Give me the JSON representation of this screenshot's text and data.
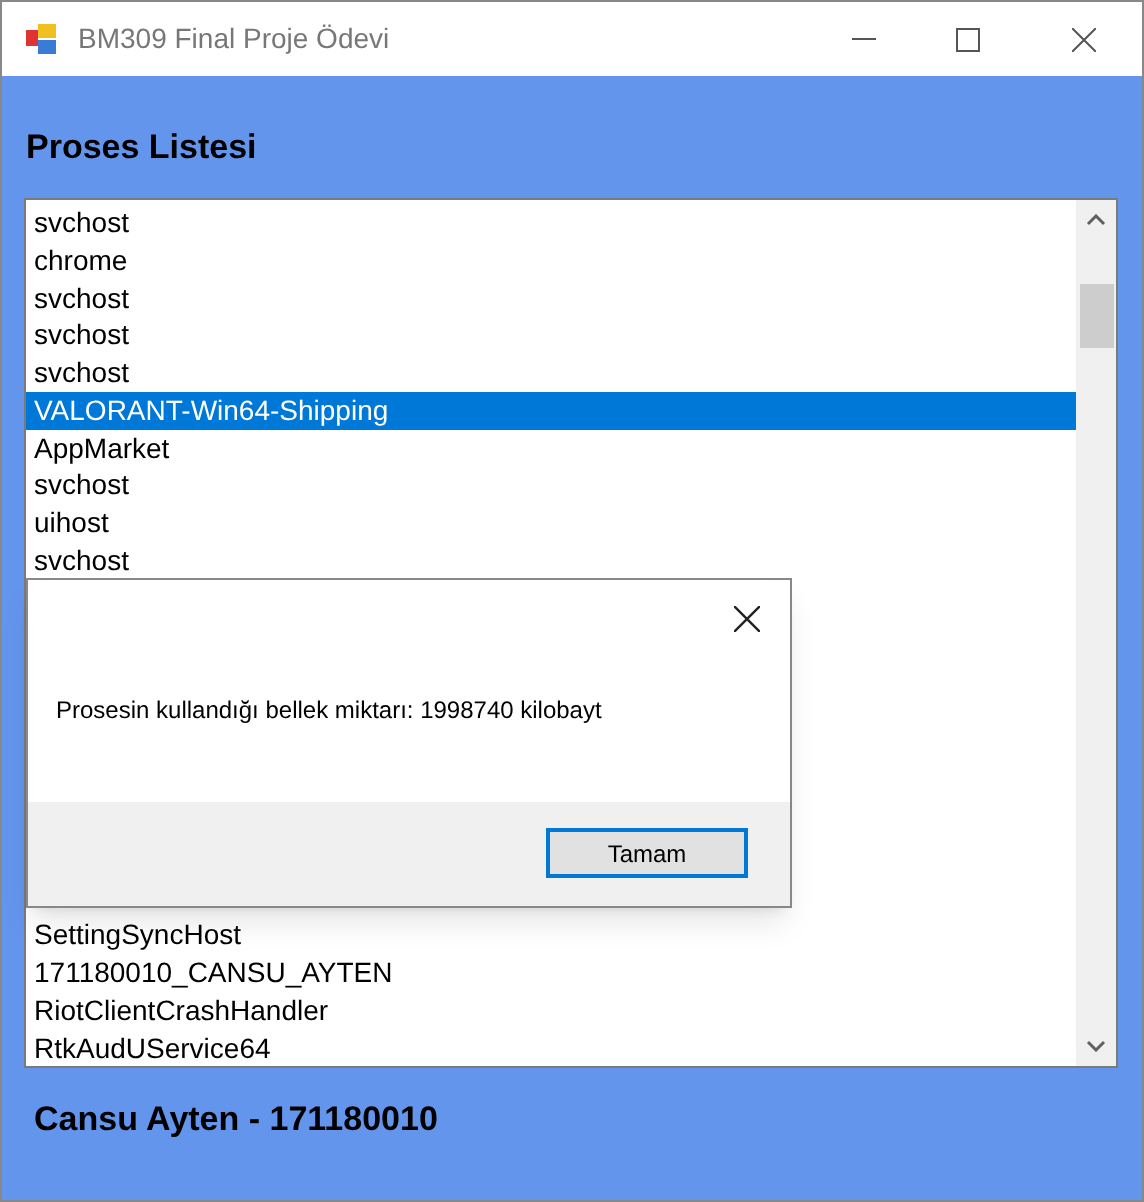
{
  "window": {
    "title": "BM309 Final Proje Ödevi"
  },
  "heading": "Proses Listesi",
  "process_list": {
    "items_above": [
      {
        "label": "svchost",
        "selected": false
      },
      {
        "label": "chrome",
        "selected": false
      },
      {
        "label": "svchost",
        "selected": false
      },
      {
        "label": "svchost",
        "selected": false
      },
      {
        "label": "svchost",
        "selected": false
      },
      {
        "label": "VALORANT-Win64-Shipping",
        "selected": true
      },
      {
        "label": "AppMarket",
        "selected": false
      },
      {
        "label": "svchost",
        "selected": false
      },
      {
        "label": "uihost",
        "selected": false
      },
      {
        "label": "svchost",
        "selected": false
      }
    ],
    "items_below": [
      {
        "label": "SettingSyncHost",
        "selected": false
      },
      {
        "label": "171180010_CANSU_AYTEN",
        "selected": false
      },
      {
        "label": "RiotClientCrashHandler",
        "selected": false
      },
      {
        "label": "RtkAudUService64",
        "selected": false
      }
    ]
  },
  "footer": "Cansu Ayten - 171180010",
  "dialog": {
    "message": "Prosesin kullandığı bellek miktarı: 1998740 kilobayt",
    "button": "Tamam"
  }
}
